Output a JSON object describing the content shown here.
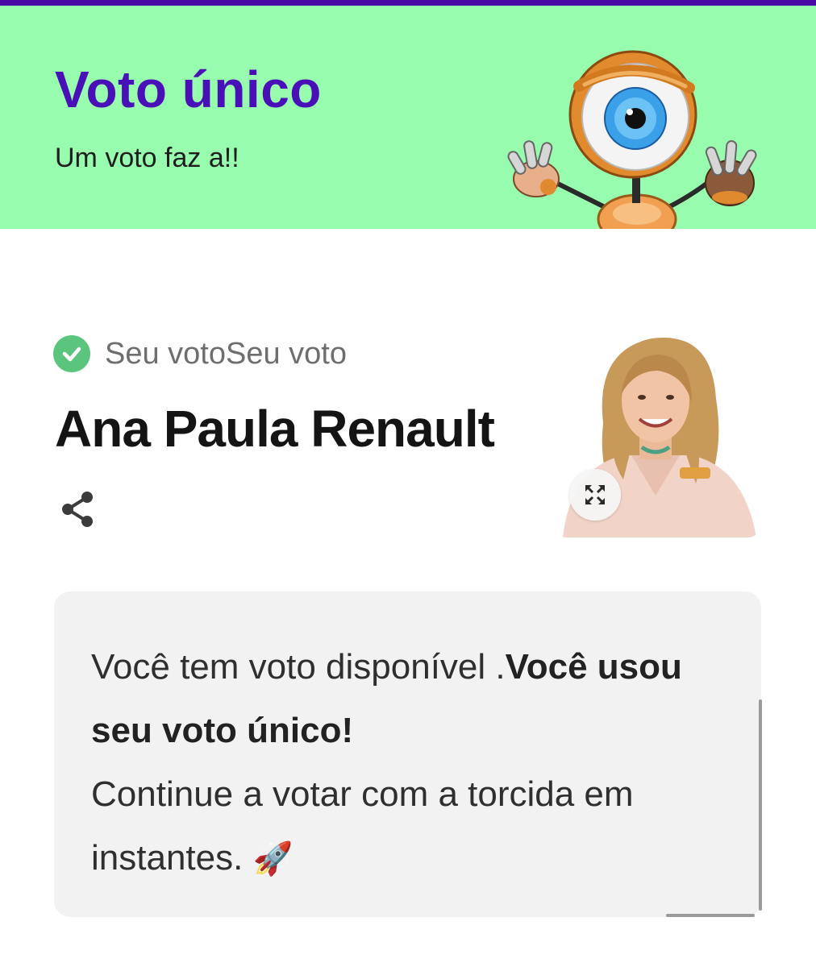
{
  "header": {
    "title": "Voto único",
    "subtitle": "Um voto faz a!!"
  },
  "vote_status": {
    "label": "Seu votoSeu voto",
    "candidate_name": "Ana Paula Renault"
  },
  "notice": {
    "text_regular": "Você tem voto disponível .",
    "text_bold": "Você usou seu voto único!",
    "line2": "Continue a votar com a torcida em instantes.",
    "emoji": "🚀"
  },
  "icons": {
    "check": "check-circle-icon",
    "share": "share-icon",
    "expand": "expand-icon",
    "mascot": "big-brother-eye-mascot"
  },
  "colors": {
    "top_strip": "#4a0aa6",
    "banner_bg": "#97fcae",
    "title": "#4a10b8",
    "check": "#5bc57d",
    "notice_bg": "#f2f2f2"
  }
}
